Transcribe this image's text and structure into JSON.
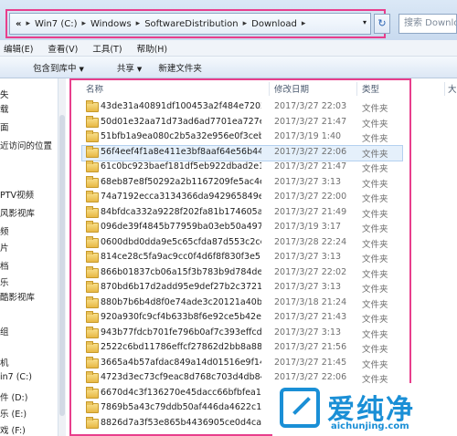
{
  "address": {
    "lead": "«",
    "crumbs": [
      "Win7 (C:)",
      "Windows",
      "SoftwareDistribution",
      "Download"
    ],
    "dropdown": "▾",
    "refresh": "↻",
    "search_placeholder": "搜索 Downloa"
  },
  "menu": [
    "编辑(E)",
    "查看(V)",
    "工具(T)",
    "帮助(H)"
  ],
  "toolbar": {
    "include": "包含到库中",
    "share": "共享",
    "new_folder": "新建文件夹"
  },
  "nav": [
    "失",
    "载",
    "面",
    "近访问的位置",
    "",
    "PTV视频",
    "风影视库",
    "频",
    "片",
    "档",
    "乐",
    "酷影视库",
    "",
    "组",
    "",
    "机",
    "in7 (C:)",
    "件 (D:)",
    "乐 (E:)",
    "戏 (F:)"
  ],
  "columns": {
    "name": "名称",
    "date": "修改日期",
    "type": "类型",
    "size": "大"
  },
  "rows": [
    {
      "name": "43de31a40891df100453a2f484e72024",
      "date": "2017/3/27 22:03",
      "type": "文件夹"
    },
    {
      "name": "50d01e32aa71d73ad6ad7701ea727e...",
      "date": "2017/3/27 21:47",
      "type": "文件夹"
    },
    {
      "name": "51bfb1a9ea080c2b5a32e956e0f3ceb1",
      "date": "2017/3/19 1:40",
      "type": "文件夹"
    },
    {
      "name": "56f4eef4f1a8e411e3bf8aaf64e56b44",
      "date": "2017/3/27 22:06",
      "type": "文件夹"
    },
    {
      "name": "61c0bc923baef181df5eb922dbad2e1a",
      "date": "2017/3/27 21:47",
      "type": "文件夹"
    },
    {
      "name": "68eb87e8f50292a2b1167209fe5ac4ed",
      "date": "2017/3/27 3:13",
      "type": "文件夹"
    },
    {
      "name": "74a7192ecca3134366da942965849e6a",
      "date": "2017/3/27 22:00",
      "type": "文件夹"
    },
    {
      "name": "84bfdca332a9228f202fa81b174605a1",
      "date": "2017/3/27 21:49",
      "type": "文件夹"
    },
    {
      "name": "096de39f4845b77959ba03eb50a49761",
      "date": "2017/3/19 3:17",
      "type": "文件夹"
    },
    {
      "name": "0600dbd0dda9e5c65cfda87d553c2ce6",
      "date": "2017/3/28 22:24",
      "type": "文件夹"
    },
    {
      "name": "814ce28c5fa9ac9cc0f4d6f8f830f3e5",
      "date": "2017/3/27 3:13",
      "type": "文件夹"
    },
    {
      "name": "866b01837cb06a15f3b783b9d784de89",
      "date": "2017/3/27 22:02",
      "type": "文件夹"
    },
    {
      "name": "870bd6b17d2add95e9def27b2c3721...",
      "date": "2017/3/27 3:13",
      "type": "文件夹"
    },
    {
      "name": "880b7b6b4d8f0e74ade3c20121a40b37",
      "date": "2017/3/18 21:24",
      "type": "文件夹"
    },
    {
      "name": "920a930fc9cf4b633b8f6e92ce5b42e9",
      "date": "2017/3/27 21:43",
      "type": "文件夹"
    },
    {
      "name": "943b77fdcb701fe796b0af7c393effcd",
      "date": "2017/3/27 3:13",
      "type": "文件夹"
    },
    {
      "name": "2522c6bd11786effcf27862d2bb8a88c",
      "date": "2017/3/27 21:56",
      "type": "文件夹"
    },
    {
      "name": "3665a4b57afdac849a14d01516e9f146",
      "date": "2017/3/27 21:45",
      "type": "文件夹"
    },
    {
      "name": "4723d3ec73cf9eac8d768c703d4db84c",
      "date": "2017/3/27 22:06",
      "type": "文件夹"
    },
    {
      "name": "6670d4c3f136270e45dacc66bfbfea14",
      "date": "2017/3/27 21:48",
      "type": "文件夹"
    },
    {
      "name": "7869b5a43c79ddb50af446da4622c1ca",
      "date": "2017/3/27 21:48",
      "type": "文件夹"
    },
    {
      "name": "8826d7a3f53e865b4436905ce0d4ca",
      "date": "2017/3/27 21:46",
      "type": "文件夹"
    }
  ],
  "selected_row": 3,
  "watermark": {
    "brand": "爱纯净",
    "url": "aichunjing.com"
  },
  "colors": {
    "highlight": "#e83e8c",
    "brand": "#1a8fd6"
  }
}
